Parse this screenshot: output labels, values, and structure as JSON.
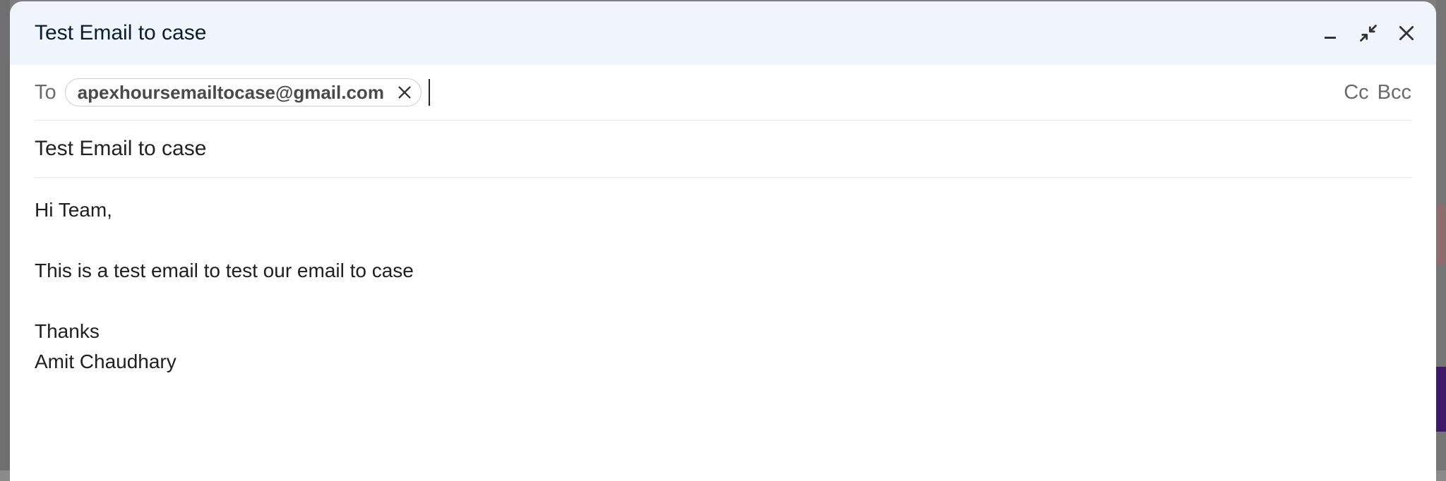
{
  "compose": {
    "title": "Test Email to case",
    "icons": {
      "minimize": "minimize-icon",
      "exit_fullscreen": "exit-fullscreen-icon",
      "close": "close-icon"
    }
  },
  "recipients": {
    "to_label": "To",
    "chips": [
      {
        "email": "apexhoursemailtocase@gmail.com"
      }
    ],
    "cc_label": "Cc",
    "bcc_label": "Bcc"
  },
  "subject": "Test Email to case",
  "body": {
    "lines": [
      "Hi Team,",
      "",
      "This is a test email to test our email to case",
      "",
      "Thanks",
      "Amit Chaudhary"
    ]
  }
}
